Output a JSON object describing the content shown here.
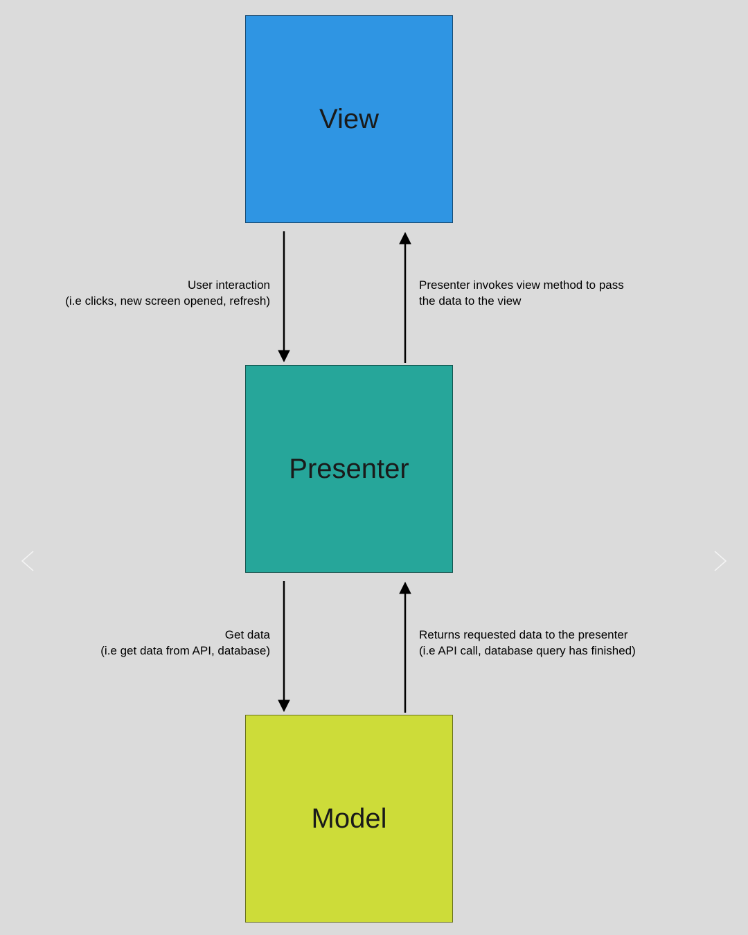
{
  "boxes": {
    "view": "View",
    "presenter": "Presenter",
    "model": "Model"
  },
  "arrows": {
    "view_to_presenter": {
      "title": "User interaction",
      "subtitle": "(i.e clicks, new screen opened, refresh)"
    },
    "presenter_to_view": {
      "title": "Presenter invokes view method to pass",
      "subtitle": "the data to the view"
    },
    "presenter_to_model": {
      "title": "Get data",
      "subtitle": "(i.e get data from API, database)"
    },
    "model_to_presenter": {
      "title": "Returns requested data to the presenter",
      "subtitle": "(i.e API call, database query has finished)"
    }
  },
  "colors": {
    "view": "#2f95e3",
    "presenter": "#26a69a",
    "model": "#cddc39",
    "background": "#dbdbdb"
  }
}
